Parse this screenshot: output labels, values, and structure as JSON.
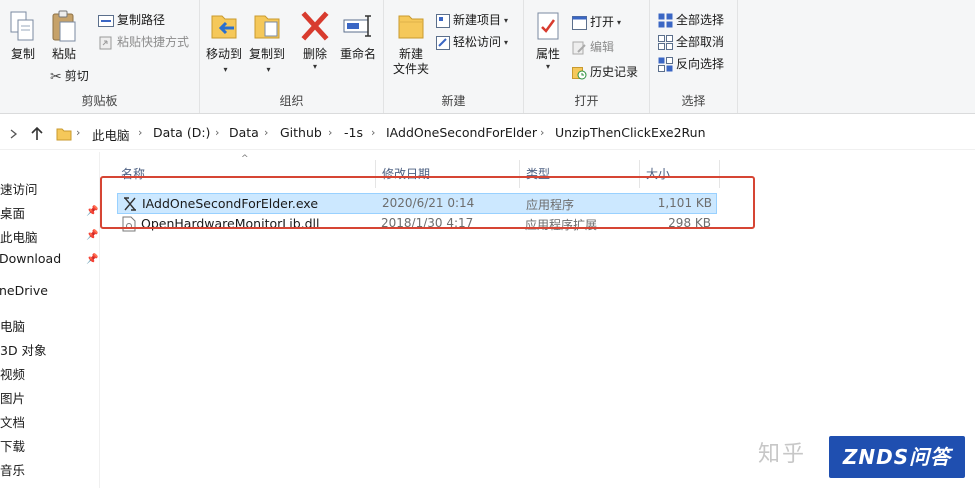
{
  "ribbon": {
    "clipboard": {
      "label": "剪贴板",
      "copy": "复制",
      "paste": "粘贴",
      "copy_path": "复制路径",
      "paste_shortcut": "粘贴快捷方式",
      "cut": "剪切"
    },
    "organize": {
      "label": "组织",
      "move_to": "移动到",
      "copy_to": "复制到",
      "delete": "删除",
      "rename": "重命名"
    },
    "new": {
      "label": "新建",
      "new_folder": "新建\n文件夹",
      "new_item": "新建项目",
      "easy_access": "轻松访问"
    },
    "open": {
      "label": "打开",
      "properties": "属性",
      "open": "打开",
      "edit": "编辑",
      "history": "历史记录"
    },
    "select": {
      "label": "选择",
      "select_all": "全部选择",
      "select_none": "全部取消",
      "invert": "反向选择"
    }
  },
  "address": {
    "crumbs": [
      "此电脑",
      "Data (D:)",
      "Data",
      "Github",
      "-1s",
      "IAddOneSecondForElder",
      "UnzipThenClickExe2Run"
    ]
  },
  "nav": {
    "items": [
      "速访问",
      "桌面",
      "此电脑",
      "Download",
      "neDrive",
      "电脑",
      "3D 对象",
      "视频",
      "图片",
      "文档",
      "下载",
      "音乐"
    ]
  },
  "files": {
    "columns": [
      "名称",
      "修改日期",
      "类型",
      "大小"
    ],
    "rows": [
      {
        "name": "IAddOneSecondForElder.exe",
        "date": "2020/6/21 0:14",
        "type": "应用程序",
        "size": "1,101 KB"
      },
      {
        "name": "OpenHardwareMonitorLib.dll",
        "date": "2018/1/30 4:17",
        "type": "应用程序扩展",
        "size": "298 KB"
      }
    ]
  },
  "watermark": {
    "zhihu": "知乎",
    "znds": "ZNDS问答"
  },
  "colors": {
    "selection": "#cce8ff",
    "highlight_box": "#d64534",
    "delete_red": "#d83b2e"
  }
}
